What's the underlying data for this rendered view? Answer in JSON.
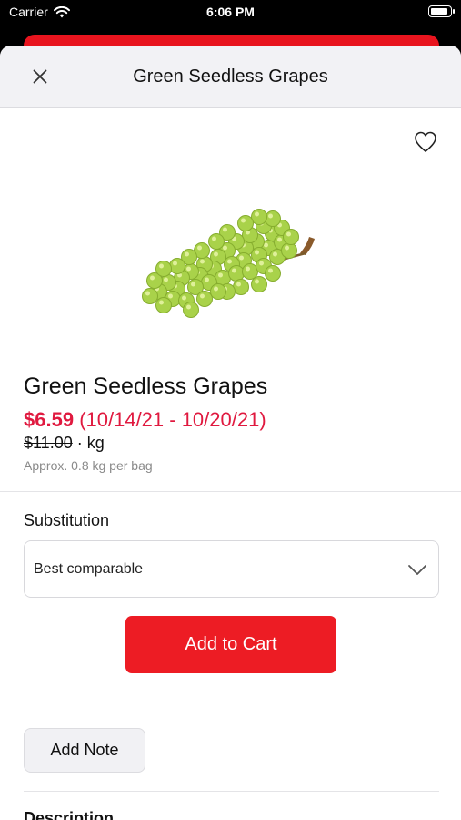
{
  "status_bar": {
    "carrier": "Carrier",
    "time": "6:06 PM",
    "wifi_icon": "wifi-icon",
    "battery_icon": "battery-icon",
    "battery_level": 0.95
  },
  "header": {
    "title": "Green Seedless Grapes",
    "close_icon": "close-icon"
  },
  "product": {
    "favorite_icon": "heart-outline-icon",
    "image": "green-grapes-image",
    "name": "Green Seedless Grapes",
    "sale_price": "$6.59",
    "sale_period": "(10/14/21 - 10/20/21)",
    "original_price": "$11.00",
    "unit": "· kg",
    "approx_note": "Approx. 0.8 kg per bag"
  },
  "substitution": {
    "label": "Substitution",
    "selected": "Best comparable",
    "chevron_icon": "chevron-down-icon"
  },
  "actions": {
    "add_to_cart": "Add to Cart",
    "add_note": "Add Note"
  },
  "description": {
    "label": "Description"
  },
  "colors": {
    "brand_red": "#ed1c24",
    "price_red": "#e0193f"
  }
}
